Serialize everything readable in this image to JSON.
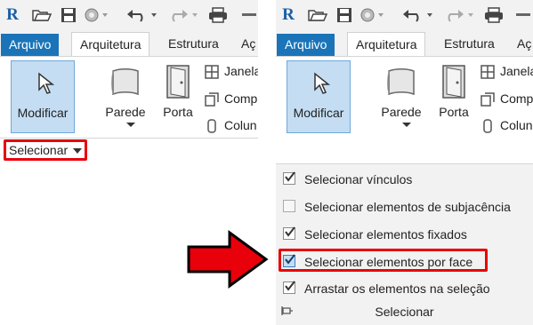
{
  "app": {
    "logo_letter": "R",
    "accent": "#1b74b8"
  },
  "tabs": {
    "file": "Arquivo",
    "architecture": "Arquitetura",
    "structure": "Estrutura",
    "more": "Aç"
  },
  "ribbon": {
    "modify": "Modificar",
    "wall": "Parede",
    "door": "Porta",
    "window": "Janela",
    "component": "Comp",
    "column": "Colun",
    "select_panel": "Selecionar"
  },
  "menu": {
    "items": [
      {
        "label": "Selecionar vínculos",
        "checked": true
      },
      {
        "label": "Selecionar elementos de subjacência",
        "checked": false
      },
      {
        "label": "Selecionar elementos fixados",
        "checked": true
      },
      {
        "label": "Selecionar elementos por face",
        "checked": true
      },
      {
        "label": "Arrastar os elementos na seleção",
        "checked": true
      }
    ],
    "footer": "Selecionar"
  },
  "highlight_color": "#e8000b",
  "icons": [
    "revit-logo-icon",
    "open-icon",
    "save-icon",
    "sync-icon",
    "undo-icon",
    "redo-icon",
    "print-icon",
    "cursor-icon",
    "wall-icon",
    "door-icon",
    "window-icon",
    "component-icon",
    "column-icon",
    "checkbox-icon",
    "pin-icon",
    "red-arrow-icon"
  ]
}
